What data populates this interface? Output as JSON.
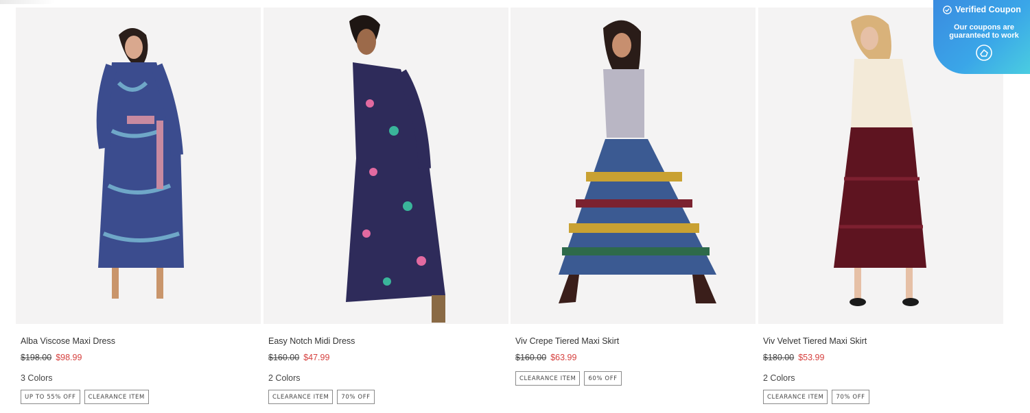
{
  "products": [
    {
      "name": "Alba Viscose Maxi Dress",
      "original_price": "$198.00",
      "sale_price": "$98.99",
      "colors": "3 Colors",
      "badges": [
        "UP TO 55% OFF",
        "CLEARANCE ITEM"
      ],
      "image_icon": "model-paisley-maxi-dress"
    },
    {
      "name": "Easy Notch Midi Dress",
      "original_price": "$160.00",
      "sale_price": "$47.99",
      "colors": "2 Colors",
      "badges": [
        "CLEARANCE ITEM",
        "70% OFF"
      ],
      "image_icon": "model-floral-midi-dress"
    },
    {
      "name": "Viv Crepe Tiered Maxi Skirt",
      "original_price": "$160.00",
      "sale_price": "$63.99",
      "colors": "",
      "badges": [
        "CLEARANCE ITEM",
        "60% OFF"
      ],
      "image_icon": "model-printed-tiered-skirt"
    },
    {
      "name": "Viv Velvet Tiered Maxi Skirt",
      "original_price": "$180.00",
      "sale_price": "$53.99",
      "colors": "2 Colors",
      "badges": [
        "CLEARANCE ITEM",
        "70% OFF"
      ],
      "image_icon": "model-velvet-tiered-skirt"
    }
  ],
  "coupon": {
    "title": "Verified Coupon",
    "subtitle": "Our coupons are guaranteed to work",
    "check_icon": "check-circle-icon",
    "logo_icon": "coupon-logo-icon"
  },
  "colors": {
    "sale_price": "#d6403e",
    "badge_border": "#8a8a8a",
    "coupon_gradient_start": "#3a8be0",
    "coupon_gradient_end": "#4cd0e0"
  }
}
